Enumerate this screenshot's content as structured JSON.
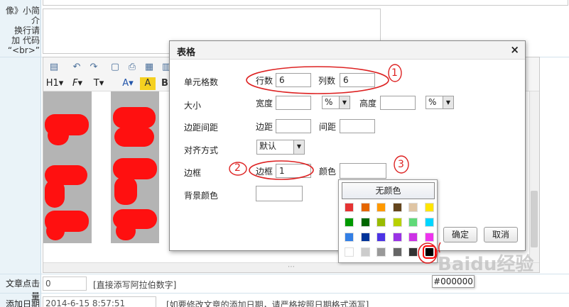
{
  "form": {
    "intro_label": "像》小简介\n换行请\n加 代码\n“<br>”",
    "clicks_label": "文章点击量",
    "clicks_value": "0",
    "clicks_hint": "[直接添写阿拉伯数字]",
    "date_label": "添加日期",
    "date_value": "2014-6-15 8:57:51",
    "date_hint": "[如要修改文章的添加日期，请严格按照日期格式添写]"
  },
  "toolbar": {
    "heading_label": "H1",
    "font_label": "F",
    "size_label": "T",
    "color_label": "A"
  },
  "dialog": {
    "title": "表格",
    "close": "×",
    "cells_label": "单元格数",
    "rows_label": "行数",
    "rows_value": "6",
    "cols_label": "列数",
    "cols_value": "6",
    "size_label": "大小",
    "width_label": "宽度",
    "width_value": "",
    "width_unit": "%",
    "height_label": "高度",
    "height_value": "",
    "height_unit": "%",
    "spacing_label": "边距间距",
    "padding_label": "边距",
    "padding_value": "",
    "gap_label": "间距",
    "gap_value": "",
    "align_label": "对齐方式",
    "align_value": "默认",
    "border_label": "边框",
    "border_field_label": "边框",
    "border_value": "1",
    "color_label": "颜色",
    "bg_label": "背景颜色",
    "ok": "确定",
    "cancel": "取消"
  },
  "picker": {
    "no_color": "无颜色",
    "rows": [
      [
        "#e53333",
        "#e56600",
        "#ff9900",
        "#64451d",
        "#dfc5a4",
        "#ffe500"
      ],
      [
        "#009900",
        "#006600",
        "#99bb00",
        "#b8d100",
        "#60d978",
        "#00d5ff"
      ],
      [
        "#337fe5",
        "#003399",
        "#4c33e5",
        "#9933e5",
        "#cc33e5",
        "#ee33ee"
      ],
      [
        "#ffffff",
        "#cccccc",
        "#999999",
        "#666666",
        "#333333",
        "#000000"
      ]
    ],
    "selected": "#000000",
    "tooltip": "#000000"
  },
  "annotations": {
    "one": "1",
    "two": "2",
    "three": "3"
  },
  "watermark": "Baidu经验"
}
